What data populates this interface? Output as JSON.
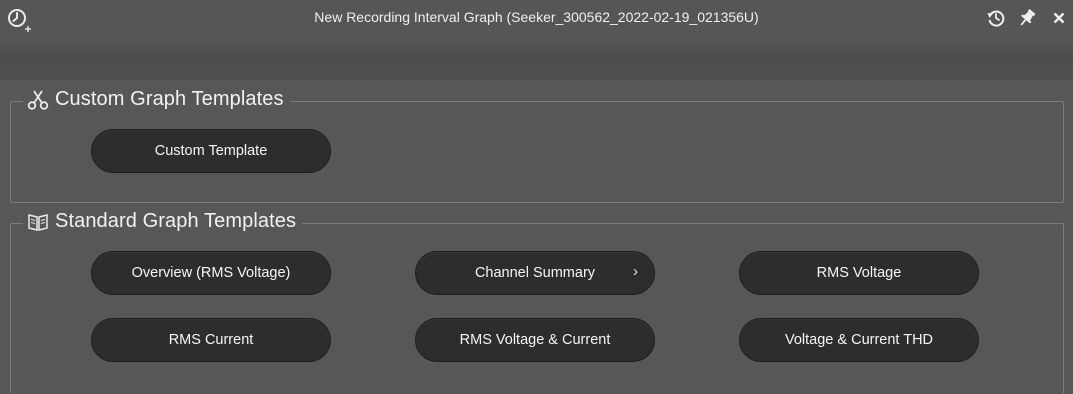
{
  "window": {
    "title": "New Recording Interval Graph (Seeker_300562_2022-02-19_021356U)"
  },
  "header_icons": [
    "clock-plus-icon",
    "history-icon",
    "pin-icon",
    "close-icon"
  ],
  "sections": {
    "custom": {
      "title": "Custom Graph Templates",
      "icon": "scissors-icon",
      "buttons": [
        "Custom Template"
      ]
    },
    "standard": {
      "title": "Standard Graph Templates",
      "icon": "book-icon",
      "buttons": [
        "Overview (RMS Voltage)",
        "Channel Summary",
        "RMS Voltage",
        "RMS Current",
        "RMS Voltage & Current",
        "Voltage & Current THD"
      ],
      "submenu_indicator": "›"
    }
  },
  "colors": {
    "background": "#555759",
    "button": "#2c2d2e",
    "border": "#7a7c7e",
    "text": "#f2f2f2"
  }
}
